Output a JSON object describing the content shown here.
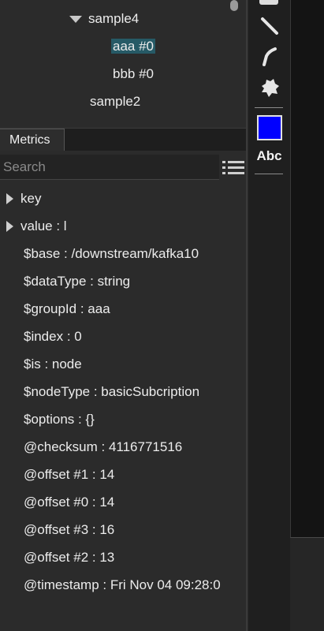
{
  "tree": {
    "items": [
      {
        "label": "sample4",
        "expanded": true
      },
      {
        "label": "aaa #0",
        "selected": true
      },
      {
        "label": "bbb #0"
      },
      {
        "label": "sample2"
      }
    ]
  },
  "tabs": {
    "metrics": "Metrics"
  },
  "search": {
    "placeholder": "Search",
    "value": ""
  },
  "properties": [
    {
      "text": "key",
      "expandable": true
    },
    {
      "text": "value : l",
      "expandable": true
    },
    {
      "text": "$base : /downstream/kafka10"
    },
    {
      "text": "$dataType : string"
    },
    {
      "text": "$groupId : aaa"
    },
    {
      "text": "$index : 0"
    },
    {
      "text": "$is : node"
    },
    {
      "text": "$nodeType : basicSubcription"
    },
    {
      "text": "$options : {}"
    },
    {
      "text": "@checksum : 4116771516"
    },
    {
      "text": "@offset #1 : 14"
    },
    {
      "text": "@offset #0 : 14"
    },
    {
      "text": "@offset #3 : 16"
    },
    {
      "text": "@offset #2 : 13"
    },
    {
      "text": "@timestamp : Fri Nov 04 09:28:0"
    }
  ],
  "toolbar": {
    "tools": [
      "line-tool-icon",
      "pen-tool-icon",
      "puzzle-tool-icon"
    ],
    "color": "#0000ff",
    "text_tool_label": "Abc"
  }
}
